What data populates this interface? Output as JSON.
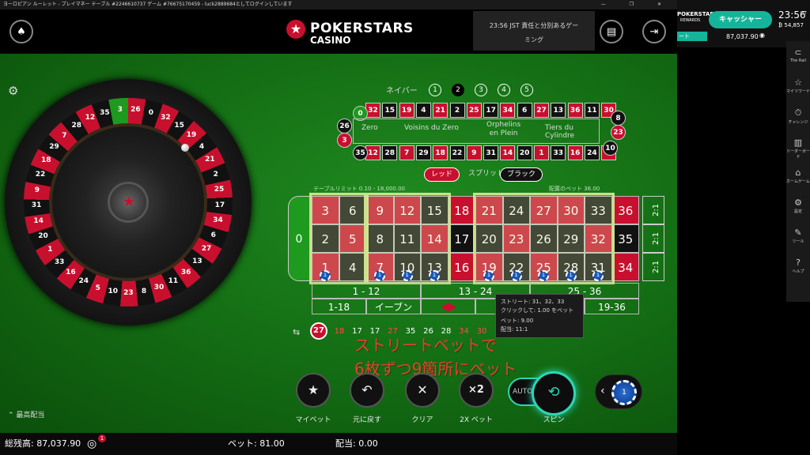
{
  "window": {
    "title": "ヨーロピアン ルーレット - プレイマネー テーブル #2246610737 ゲーム #76675170459 - luck2889684としてログインしています",
    "controls": "— ❐ ✕"
  },
  "header": {
    "logo_top": "POKERSTARS",
    "logo_bottom": "CASINO",
    "clock_line1": "23:56 JST 責任と分別あるゲー",
    "clock_line2": "ミング"
  },
  "wheel_numbers": [
    "0",
    "32",
    "15",
    "19",
    "4",
    "21",
    "2",
    "25",
    "17",
    "34",
    "6",
    "27",
    "13",
    "36",
    "11",
    "30",
    "8",
    "23",
    "10",
    "5",
    "24",
    "16",
    "33",
    "1",
    "20",
    "14",
    "31",
    "9",
    "22",
    "18",
    "29",
    "7",
    "28",
    "12",
    "35",
    "3",
    "26"
  ],
  "neighbors": {
    "label": "ネイバー",
    "options": [
      "1",
      "2",
      "3",
      "4",
      "5"
    ],
    "selected": "2"
  },
  "racetrack": {
    "top": [
      {
        "n": "32",
        "c": "r"
      },
      {
        "n": "15",
        "c": "b"
      },
      {
        "n": "19",
        "c": "r"
      },
      {
        "n": "4",
        "c": "b"
      },
      {
        "n": "21",
        "c": "r"
      },
      {
        "n": "2",
        "c": "b"
      },
      {
        "n": "25",
        "c": "r"
      },
      {
        "n": "17",
        "c": "b"
      },
      {
        "n": "34",
        "c": "r"
      },
      {
        "n": "6",
        "c": "b"
      },
      {
        "n": "27",
        "c": "r"
      },
      {
        "n": "13",
        "c": "b"
      },
      {
        "n": "36",
        "c": "r"
      },
      {
        "n": "11",
        "c": "b"
      },
      {
        "n": "30",
        "c": "r"
      }
    ],
    "bottom": [
      {
        "n": "12",
        "c": "r"
      },
      {
        "n": "28",
        "c": "b"
      },
      {
        "n": "7",
        "c": "r"
      },
      {
        "n": "29",
        "c": "b"
      },
      {
        "n": "18",
        "c": "r"
      },
      {
        "n": "22",
        "c": "b"
      },
      {
        "n": "9",
        "c": "r"
      },
      {
        "n": "31",
        "c": "b"
      },
      {
        "n": "14",
        "c": "r"
      },
      {
        "n": "20",
        "c": "b"
      },
      {
        "n": "1",
        "c": "r"
      },
      {
        "n": "33",
        "c": "b"
      },
      {
        "n": "16",
        "c": "r"
      },
      {
        "n": "24",
        "c": "b"
      },
      {
        "n": "5",
        "c": "r"
      }
    ],
    "left": [
      {
        "n": "0",
        "c": "g"
      },
      {
        "n": "26",
        "c": "b"
      },
      {
        "n": "3",
        "c": "r"
      },
      {
        "n": "35",
        "c": "b"
      }
    ],
    "right": [
      {
        "n": "8",
        "c": "b"
      },
      {
        "n": "23",
        "c": "r"
      },
      {
        "n": "10",
        "c": "b"
      }
    ],
    "sections": [
      "Zero",
      "Voisins du Zero",
      "Orphelins\nen Plein",
      "Tiers du Cylindre"
    ]
  },
  "toggle": {
    "red": "レッド",
    "split": "スプリット",
    "black": "ブラック"
  },
  "limits": {
    "table": "テーブルリミット 0.10 - 18,000.00",
    "bets": "配置のベット 36.00"
  },
  "table": {
    "zero": "0",
    "rows": [
      [
        {
          "n": "3",
          "c": "r"
        },
        {
          "n": "6",
          "c": "b"
        },
        {
          "n": "9",
          "c": "r"
        },
        {
          "n": "12",
          "c": "r"
        },
        {
          "n": "15",
          "c": "b"
        },
        {
          "n": "18",
          "c": "r"
        },
        {
          "n": "21",
          "c": "r"
        },
        {
          "n": "24",
          "c": "b"
        },
        {
          "n": "27",
          "c": "r"
        },
        {
          "n": "30",
          "c": "r"
        },
        {
          "n": "33",
          "c": "b"
        },
        {
          "n": "36",
          "c": "r"
        }
      ],
      [
        {
          "n": "2",
          "c": "b"
        },
        {
          "n": "5",
          "c": "r"
        },
        {
          "n": "8",
          "c": "b"
        },
        {
          "n": "11",
          "c": "b"
        },
        {
          "n": "14",
          "c": "r"
        },
        {
          "n": "17",
          "c": "b"
        },
        {
          "n": "20",
          "c": "b"
        },
        {
          "n": "23",
          "c": "r"
        },
        {
          "n": "26",
          "c": "b"
        },
        {
          "n": "29",
          "c": "b"
        },
        {
          "n": "32",
          "c": "r"
        },
        {
          "n": "35",
          "c": "b"
        }
      ],
      [
        {
          "n": "1",
          "c": "r"
        },
        {
          "n": "4",
          "c": "b"
        },
        {
          "n": "7",
          "c": "r"
        },
        {
          "n": "10",
          "c": "b"
        },
        {
          "n": "13",
          "c": "b"
        },
        {
          "n": "16",
          "c": "r"
        },
        {
          "n": "19",
          "c": "r"
        },
        {
          "n": "22",
          "c": "b"
        },
        {
          "n": "25",
          "c": "r"
        },
        {
          "n": "28",
          "c": "b"
        },
        {
          "n": "31",
          "c": "b"
        },
        {
          "n": "34",
          "c": "r"
        }
      ]
    ],
    "columns": [
      "2:1",
      "2:1",
      "2:1"
    ],
    "dozens": [
      "1 - 12",
      "13 - 24",
      "25 - 36"
    ],
    "outside": [
      "1-18",
      "イーブン",
      "",
      "",
      "オッド",
      "19-36"
    ],
    "chip_value": "1"
  },
  "tooltip": {
    "line1": "ストリート: 31、32、33",
    "line2": "クリックして: 1.00 をベット",
    "line3": "ベット: 9.00",
    "line4": "配当: 11:1"
  },
  "history": {
    "last": "27",
    "items": [
      {
        "n": "18",
        "c": "r"
      },
      {
        "n": "17",
        "c": "b"
      },
      {
        "n": "17",
        "c": "b"
      },
      {
        "n": "27",
        "c": "r"
      },
      {
        "n": "35",
        "c": "b"
      },
      {
        "n": "26",
        "c": "b"
      },
      {
        "n": "28",
        "c": "b"
      },
      {
        "n": "34",
        "c": "r"
      },
      {
        "n": "30",
        "c": "r"
      }
    ]
  },
  "annotation": {
    "line1": "ストリートベットで",
    "line2": "6枚ずつ9箇所にベット"
  },
  "actions": {
    "mybet": "マイベット",
    "undo": "元に戻す",
    "clear": "クリア",
    "double": "2X ベット",
    "double_icon": "×2",
    "spin": "スピン",
    "auto": "AUTO"
  },
  "max_payout": "最高配当",
  "bottom": {
    "balance": "総残高: 87,037.90",
    "bet": "ベット: 81.00",
    "payout": "配当: 0.00",
    "badge": "1"
  },
  "right_panel": {
    "brand": "POKERSTARS",
    "brand_sub": "REWARDS",
    "cashier": "キャッシャー",
    "time": "23:56",
    "tz": "JST",
    "balance": "87,037.90",
    "points": "54,857",
    "small": "ート"
  },
  "side_menu": [
    {
      "icon": "rail-icon",
      "label": "The Rail",
      "g": "⊂"
    },
    {
      "icon": "rewards-icon",
      "label": "マイリワード",
      "g": "☆"
    },
    {
      "icon": "challenge-icon",
      "label": "チャレンジ",
      "g": "⏱"
    },
    {
      "icon": "leaderboard-icon",
      "label": "リーダーボード",
      "g": "▥"
    },
    {
      "icon": "home-icon",
      "label": "ホームゲーム",
      "g": "⌂"
    },
    {
      "icon": "settings-icon",
      "label": "設定",
      "g": "⚙"
    },
    {
      "icon": "tools-icon",
      "label": "ツール",
      "g": "✎"
    },
    {
      "icon": "help-icon",
      "label": "ヘルプ",
      "g": "?"
    }
  ]
}
